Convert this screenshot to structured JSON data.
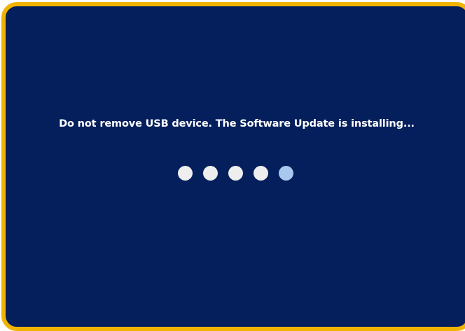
{
  "screen": {
    "message": "Do not remove USB device. The Software Update is installing...",
    "progress_dots": [
      {
        "state": "done"
      },
      {
        "state": "done"
      },
      {
        "state": "done"
      },
      {
        "state": "done"
      },
      {
        "state": "active"
      }
    ],
    "colors": {
      "background": "#041f5c",
      "frame": "#f0b400",
      "dot": "#eeeeee",
      "active_dot": "#a8c8ee"
    }
  }
}
